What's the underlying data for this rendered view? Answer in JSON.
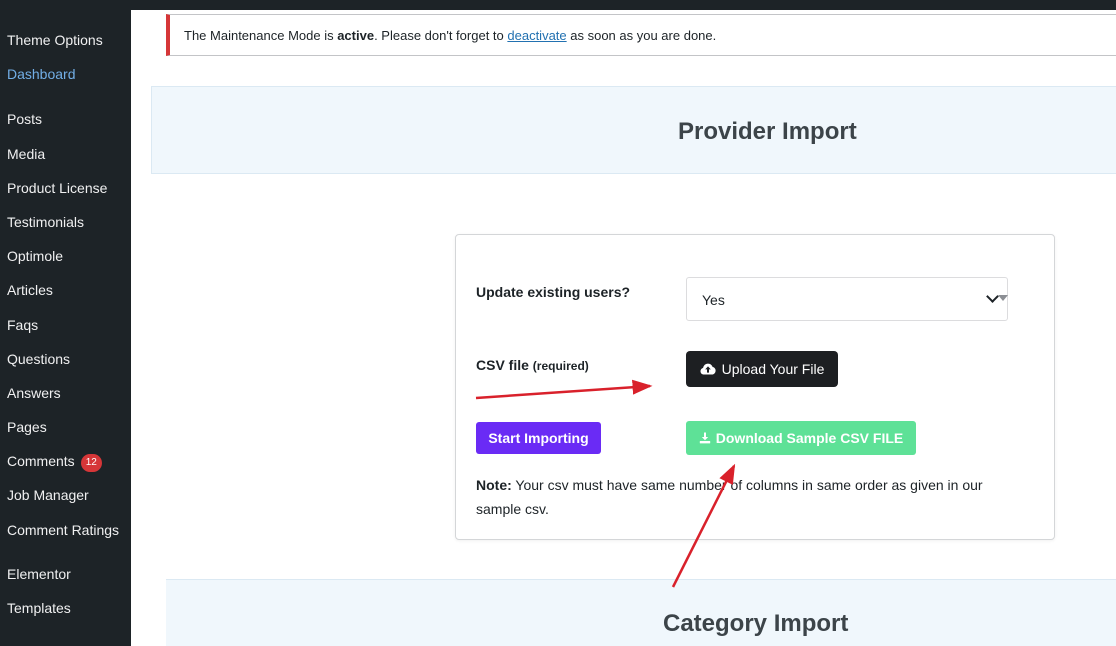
{
  "sidebar": {
    "items": [
      {
        "label": "Theme Options"
      },
      {
        "label": "Dashboard"
      },
      {
        "label": "Posts"
      },
      {
        "label": "Media"
      },
      {
        "label": "Product License"
      },
      {
        "label": "Testimonials"
      },
      {
        "label": "Optimole"
      },
      {
        "label": "Articles"
      },
      {
        "label": "Faqs"
      },
      {
        "label": "Questions"
      },
      {
        "label": "Answers"
      },
      {
        "label": "Pages"
      },
      {
        "label": "Comments",
        "badge": "12"
      },
      {
        "label": "Job Manager"
      },
      {
        "label": "Comment Ratings"
      },
      {
        "label": "Elementor"
      },
      {
        "label": "Templates"
      }
    ]
  },
  "notice": {
    "text_before": "The Maintenance Mode is ",
    "strong": "active",
    "text_middle": ". Please don't forget to ",
    "link": "deactivate",
    "text_after": " as soon as you are done."
  },
  "provider_import": {
    "title": "Provider Import",
    "update_label": "Update existing users?",
    "update_value": "Yes",
    "csv_label": "CSV file",
    "csv_required": "(required)",
    "upload_button": "Upload Your File",
    "start_button": "Start Importing",
    "download_button": "Download Sample CSV FILE",
    "note_label": "Note:",
    "note_text": " Your csv must have same number of columns in same order as given in our sample csv."
  },
  "category_import": {
    "title": "Category Import"
  },
  "colors": {
    "sidebar_bg": "#1d2327",
    "notice_border": "#d63638",
    "start_button": "#6a2bf5",
    "download_button": "#5ee197",
    "annotation_arrow": "#d9212b"
  },
  "icons": {
    "upload": "cloud-upload-icon",
    "download": "download-icon"
  }
}
